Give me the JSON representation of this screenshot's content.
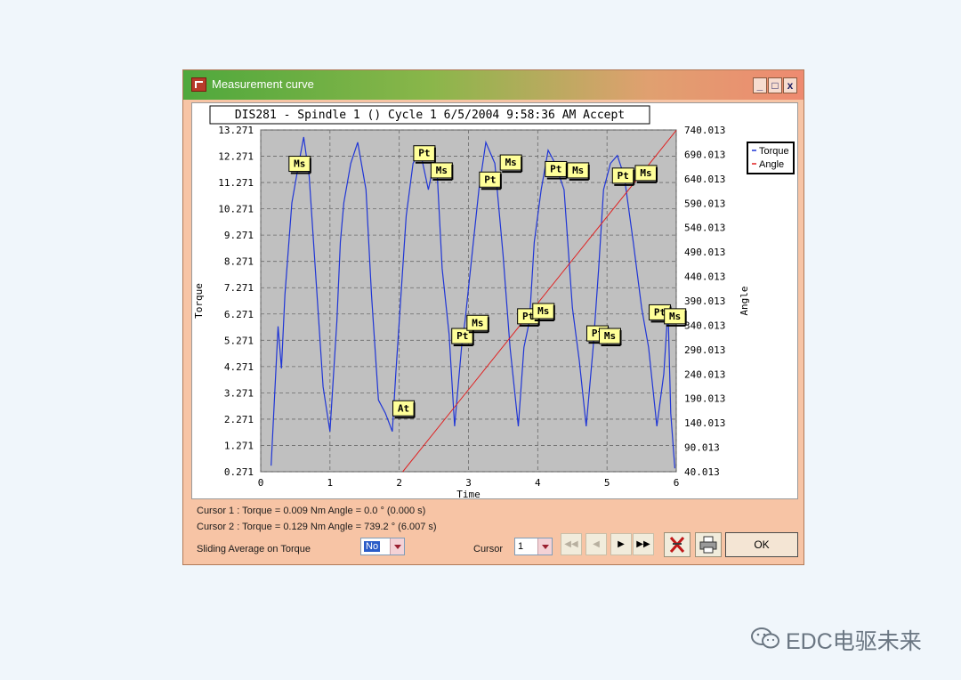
{
  "window": {
    "title": "Measurement curve",
    "controls": {
      "minimize": "_",
      "maximize": "□",
      "close": "x"
    }
  },
  "chart_data": {
    "type": "line",
    "title": "DIS281 - Spindle 1 () Cycle 1 6/5/2004 9:58:36 AM Accept",
    "xlabel": "Time",
    "ylabel_left": "Torque",
    "ylabel_right": "Angle",
    "xlim": [
      0,
      6
    ],
    "ylim_left": [
      0.271,
      13.271
    ],
    "ylim_right": [
      40.013,
      740.013
    ],
    "x_ticks": [
      "0",
      "1",
      "2",
      "3",
      "4",
      "5",
      "6"
    ],
    "y_ticks_left": [
      "13.271",
      "12.271",
      "11.271",
      "10.271",
      "9.271",
      "8.271",
      "7.271",
      "6.271",
      "5.271",
      "4.271",
      "3.271",
      "2.271",
      "1.271",
      "0.271"
    ],
    "y_ticks_right": [
      "740.013",
      "690.013",
      "640.013",
      "590.013",
      "540.013",
      "490.013",
      "440.013",
      "390.013",
      "340.013",
      "290.013",
      "240.013",
      "190.013",
      "140.013",
      "90.013",
      "40.013"
    ],
    "legend": [
      "Torque",
      "Angle"
    ],
    "legend_position": "right",
    "grid": true,
    "colors": {
      "Torque": "#1f35d6",
      "Angle": "#e02020",
      "plot_bg": "#c0c0c0",
      "marker_bg": "#ffff99"
    },
    "series": [
      {
        "name": "Torque",
        "x": [
          0.15,
          0.25,
          0.3,
          0.35,
          0.45,
          0.55,
          0.62,
          0.7,
          0.8,
          0.9,
          1.0,
          1.1,
          1.15,
          1.2,
          1.3,
          1.4,
          1.52,
          1.6,
          1.7,
          1.8,
          1.9,
          1.95,
          2.05,
          2.1,
          2.2,
          2.3,
          2.42,
          2.5,
          2.55,
          2.62,
          2.72,
          2.8,
          2.9,
          2.95,
          3.05,
          3.15,
          3.25,
          3.38,
          3.5,
          3.6,
          3.72,
          3.8,
          3.88,
          3.95,
          4.05,
          4.15,
          4.25,
          4.38,
          4.5,
          4.6,
          4.7,
          4.8,
          4.88,
          4.95,
          5.05,
          5.15,
          5.25,
          5.38,
          5.5,
          5.6,
          5.72,
          5.82,
          5.88,
          5.92,
          5.98
        ],
        "values": [
          0.5,
          5.8,
          4.2,
          7.0,
          10.5,
          12.0,
          13.0,
          11.5,
          7.5,
          3.5,
          1.8,
          6.0,
          9.0,
          10.5,
          12.0,
          12.8,
          11.0,
          7.0,
          3.0,
          2.5,
          1.8,
          4.0,
          8.0,
          10.0,
          12.0,
          12.5,
          11.0,
          12.0,
          11.5,
          8.0,
          5.5,
          2.0,
          5.0,
          6.0,
          8.5,
          11.0,
          12.8,
          12.0,
          8.5,
          5.0,
          2.0,
          5.0,
          6.0,
          9.0,
          11.0,
          12.5,
          12.0,
          11.0,
          6.5,
          4.5,
          2.0,
          5.0,
          8.0,
          11.0,
          12.0,
          12.3,
          11.5,
          9.0,
          6.5,
          5.0,
          2.0,
          4.0,
          6.5,
          2.5,
          0.4
        ]
      },
      {
        "name": "Angle",
        "x": [
          2.05,
          6.0
        ],
        "values": [
          0,
          739.2
        ]
      }
    ],
    "markers": [
      {
        "label": "Ms",
        "x": 0.55,
        "y": 12.0
      },
      {
        "label": "Pt",
        "x": 2.35,
        "y": 12.4
      },
      {
        "label": "Ms",
        "x": 2.6,
        "y": 11.75
      },
      {
        "label": "Pt",
        "x": 3.3,
        "y": 11.4
      },
      {
        "label": "Ms",
        "x": 3.6,
        "y": 12.05
      },
      {
        "label": "Pt",
        "x": 4.25,
        "y": 11.8
      },
      {
        "label": "Ms",
        "x": 4.57,
        "y": 11.75
      },
      {
        "label": "Pt",
        "x": 5.22,
        "y": 11.55
      },
      {
        "label": "Ms",
        "x": 5.55,
        "y": 11.65
      },
      {
        "label": "Pt",
        "x": 2.9,
        "y": 5.45
      },
      {
        "label": "Ms",
        "x": 3.12,
        "y": 5.95
      },
      {
        "label": "Pt",
        "x": 3.85,
        "y": 6.2
      },
      {
        "label": "Ms",
        "x": 4.07,
        "y": 6.4
      },
      {
        "label": "Pt",
        "x": 4.85,
        "y": 5.55
      },
      {
        "label": "Ms",
        "x": 5.03,
        "y": 5.45
      },
      {
        "label": "Pt",
        "x": 5.75,
        "y": 6.35
      },
      {
        "label": "Ms",
        "x": 5.97,
        "y": 6.2
      },
      {
        "label": "At",
        "x": 2.05,
        "y": 2.7
      }
    ]
  },
  "status": {
    "cursor1": "Cursor 1 : Torque = 0.009 Nm  Angle = 0.0 °   (0.000 s)",
    "cursor2": "Cursor 2 : Torque = 0.129 Nm  Angle = 739.2 °   (6.007 s)",
    "sliding_label": "Sliding Average on Torque",
    "sliding_value": "No",
    "cursor_label": "Cursor",
    "cursor_value": "1"
  },
  "buttons": {
    "first": "◀◀",
    "prev": "◀",
    "next": "▶",
    "last": "▶▶",
    "ok": "OK",
    "clear_icon": "cursor-clear-icon",
    "print_icon": "printer-icon"
  },
  "watermark": {
    "text": "EDC电驱未来",
    "icon": "wechat-icon"
  }
}
